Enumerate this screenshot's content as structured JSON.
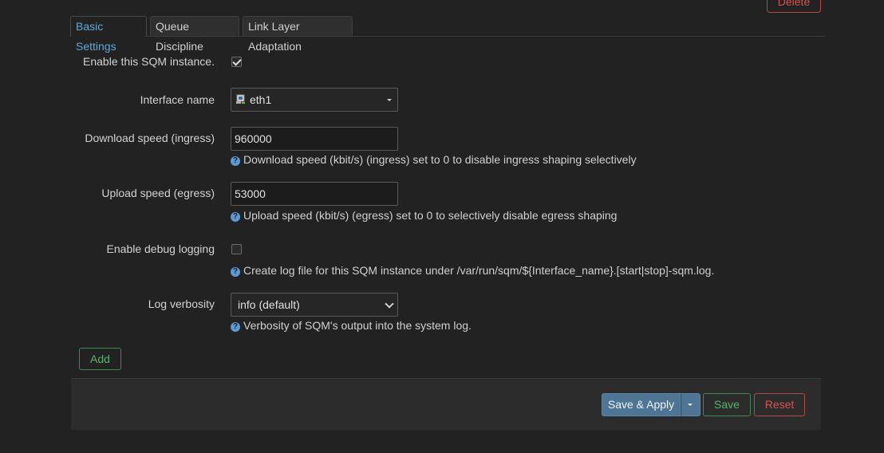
{
  "top_button": "Delete",
  "tabs": [
    {
      "label": "Basic Settings",
      "active": true
    },
    {
      "label": "Queue Discipline",
      "active": false
    },
    {
      "label": "Link Layer Adaptation",
      "active": false
    }
  ],
  "form": {
    "enable": {
      "label": "Enable this SQM instance.",
      "checked": true
    },
    "interface": {
      "label": "Interface name",
      "value": "eth1",
      "icon": "network-interface-icon"
    },
    "download": {
      "label": "Download speed (ingress)",
      "value": "960000",
      "help": "Download speed (kbit/s) (ingress) set to 0 to disable ingress shaping selectively"
    },
    "upload": {
      "label": "Upload speed (egress)",
      "value": "53000",
      "help": "Upload speed (kbit/s) (egress) set to 0 to selectively disable egress shaping"
    },
    "debug": {
      "label": "Enable debug logging",
      "checked": false,
      "help": "Create log file for this SQM instance under /var/run/sqm/${Interface_name}.[start|stop]-sqm.log."
    },
    "verbosity": {
      "label": "Log verbosity",
      "value": "info (default)",
      "help": "Verbosity of SQM's output into the system log."
    }
  },
  "add_button": "Add",
  "footer": {
    "save_apply": "Save & Apply",
    "save": "Save",
    "reset": "Reset"
  },
  "colors": {
    "background": "#222222",
    "accent_blue": "#5fa8d8",
    "success_green": "#56b36a",
    "danger_red": "#d9534f",
    "primary_button": "#4e7594"
  }
}
